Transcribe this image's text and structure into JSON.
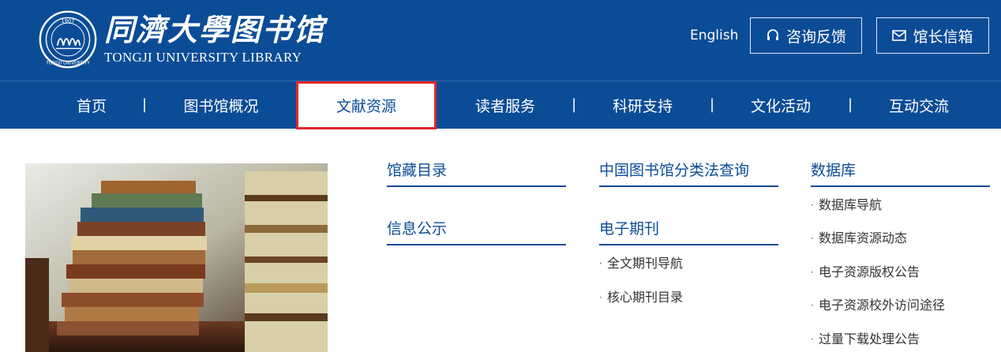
{
  "header": {
    "logo_cn": "同濟大學图书馆",
    "logo_en": "TONGJI UNIVERSITY LIBRARY",
    "seal_year": "1907",
    "seal_text": "TONGJI UNIVERSITY",
    "english_label": "English",
    "feedback_label": "咨询反馈",
    "mailbox_label": "馆长信箱"
  },
  "nav": {
    "items": [
      "首页",
      "图书馆概况",
      "文献资源",
      "读者服务",
      "科研支持",
      "文化活动",
      "互动交流"
    ],
    "separator": "|",
    "active_index": 2
  },
  "menu": {
    "col1": {
      "titles": [
        "馆藏目录",
        "信息公示"
      ]
    },
    "col2": {
      "titles": [
        "中国图书馆分类法查询",
        "电子期刊"
      ],
      "items": [
        "全文期刊导航",
        "核心期刊目录"
      ]
    },
    "col3": {
      "title": "数据库",
      "items": [
        "数据库导航",
        "数据库资源动态",
        "电子资源版权公告",
        "电子资源校外访问途径",
        "过量下载处理公告"
      ]
    },
    "bullet": "·"
  },
  "colors": {
    "brand_blue": "#0b4c97",
    "highlight_red": "#e0262a"
  }
}
